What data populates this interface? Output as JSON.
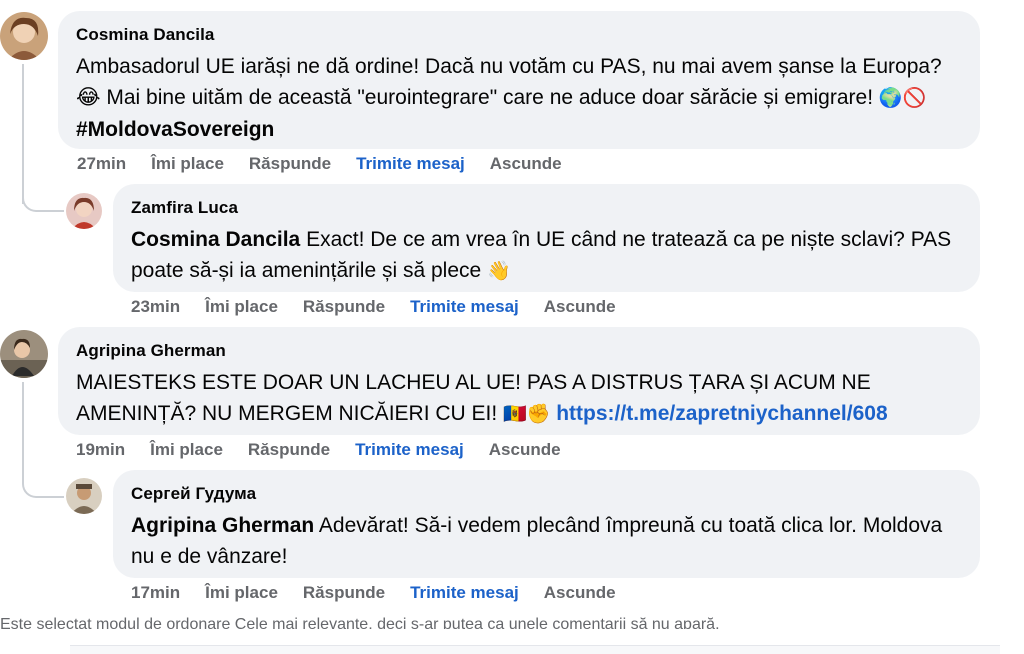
{
  "comments": [
    {
      "author": "Cosmina Dancila",
      "text": "Ambasadorul UE iarăși ne dă ordine! Dacă nu votăm cu PAS, nu mai avem șanse la Europa? 😂 Mai bine uităm de această \"eurointegrare\" care ne aduce doar sărăcie și emigrare! ",
      "emoji": "🌍🚫",
      "hashtag": "#MoldovaSovereign",
      "time": "27min"
    },
    {
      "author": "Zamfira Luca",
      "mention": "Cosmina Dancila",
      "text": " Exact! De ce am vrea în UE când ne tratează ca pe niște sclavi? PAS poate să-și ia amenințările și să plece ",
      "emoji": "👋",
      "time": "23min"
    },
    {
      "author": "Agripina Gherman",
      "text": "MAIESTEKS ESTE DOAR UN LACHEU AL UE! PAS A DISTRUS ȚARA ȘI ACUM NE AMENINȚĂ? NU MERGEM NICĂIERI CU EI! ",
      "emoji": "🇲🇩✊",
      "link": "https://t.me/zapretniychannel/608",
      "time": "19min"
    },
    {
      "author": "Сергей Гудума",
      "mention": "Agripina Gherman",
      "text": " Adevărat! Să-i vedem plecând împreună cu toată clica lor. Moldova nu e de vânzare!",
      "time": "17min"
    }
  ],
  "actions": {
    "like": "Îmi place",
    "reply": "Răspunde",
    "send": "Trimite mesaj",
    "hide": "Ascunde"
  },
  "footer": {
    "note": "Este selectat modul de ordonare Cele mai relevante, deci s-ar putea ca unele comentarii să nu apară."
  },
  "colors": {
    "bubble": "#f0f2f5",
    "link": "#1c62c9",
    "secondary_text": "#65676b"
  }
}
